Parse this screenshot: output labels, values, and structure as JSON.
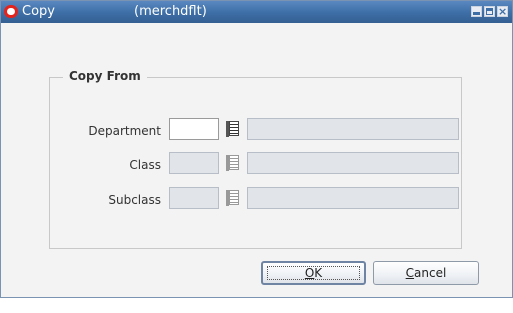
{
  "window": {
    "title": "Copy",
    "subtitle": "(merchdflt)",
    "controls": [
      "minimize",
      "maximize",
      "close"
    ]
  },
  "copy_from": {
    "group_label": "Copy From",
    "rows": [
      {
        "label": "Department",
        "value": "",
        "enabled": true
      },
      {
        "label": "Class",
        "value": "",
        "enabled": false
      },
      {
        "label": "Subclass",
        "value": "",
        "enabled": false
      }
    ]
  },
  "buttons": {
    "ok": {
      "mnemonic": "O",
      "rest": "K"
    },
    "cancel": {
      "mnemonic": "C",
      "rest": "ancel"
    }
  },
  "icons": {
    "app": "oracle-o-icon",
    "lov": "list-of-values-icon"
  },
  "colors": {
    "titlebar": "#3d6ea6",
    "app_icon": "#e3231c",
    "disabled_field": "#e1e4e9"
  }
}
